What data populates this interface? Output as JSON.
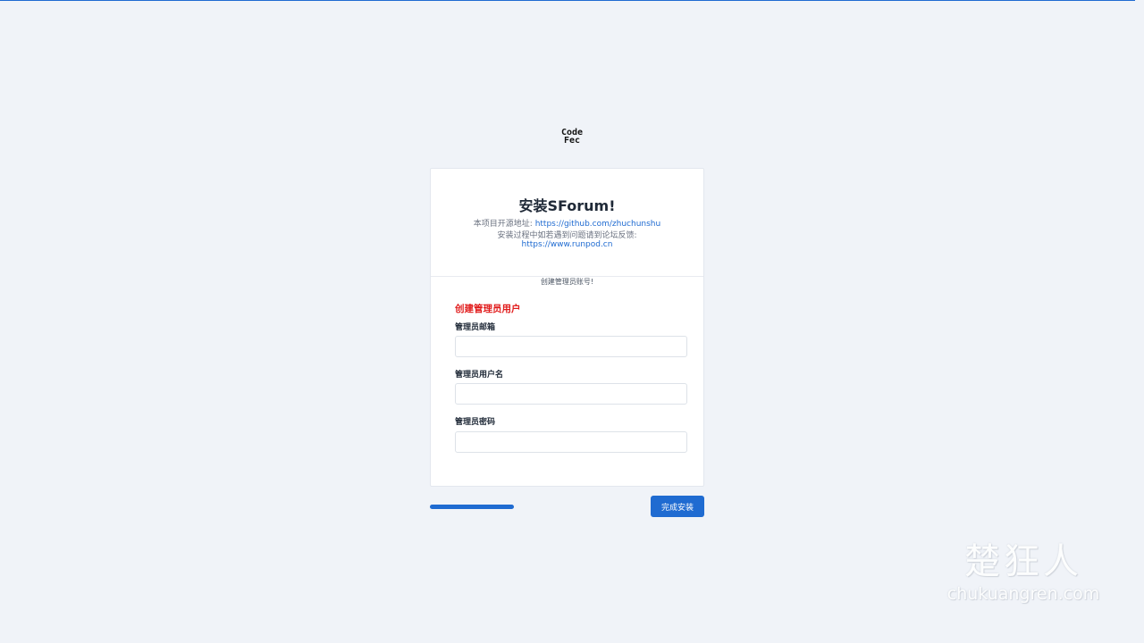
{
  "logo": {
    "line1": "Code",
    "line2": "Fec"
  },
  "card": {
    "title": "安装SForum!",
    "repo_prefix": "本项目开源地址: ",
    "repo_url": "https://github.com/zhuchunshu",
    "feedback_text": "安装过程中如若遇到问题请到论坛反馈:",
    "forum_url": "https://www.runpod.cn",
    "step_label": "创建管理员账号!"
  },
  "form": {
    "section_title": "创建管理员用户",
    "email_label": "管理员邮箱",
    "email_value": "",
    "username_label": "管理员用户名",
    "username_value": "",
    "password_label": "管理员密码",
    "password_value": ""
  },
  "footer": {
    "progress": 1.0,
    "finish_label": "完成安装"
  },
  "watermark": {
    "cn": "楚狂人",
    "en": "chukuangren.com"
  },
  "colors": {
    "accent": "#1f6bd1",
    "background": "#f0f3f8",
    "section_title": "#e11d1d"
  }
}
